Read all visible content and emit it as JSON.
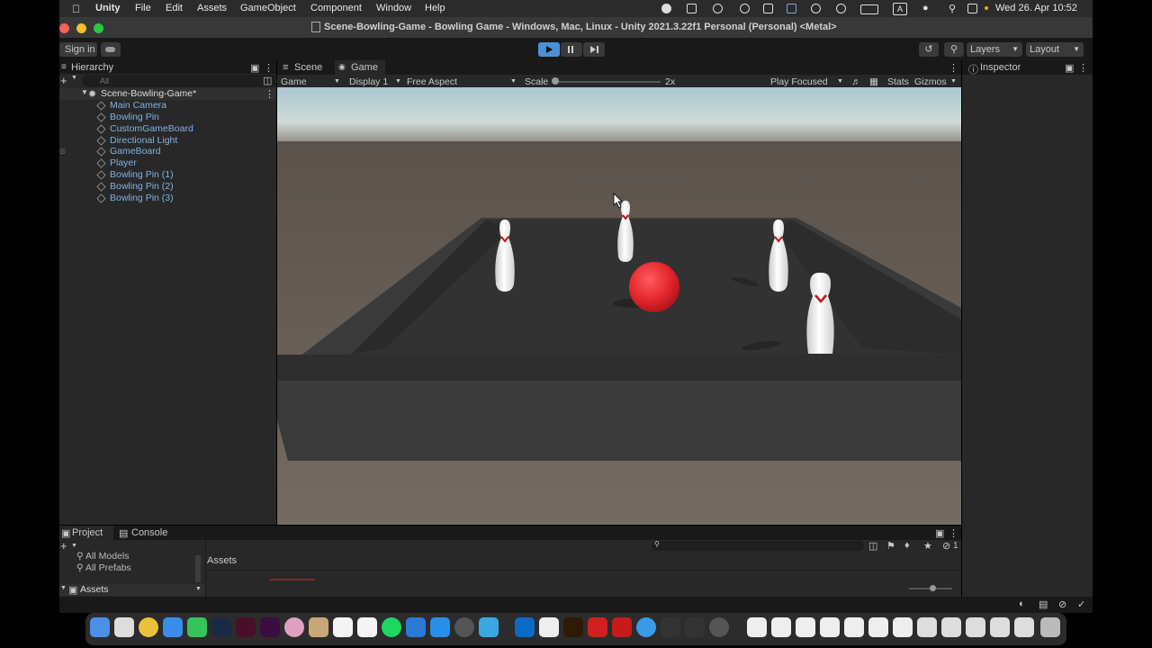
{
  "menubar": {
    "app": "Unity",
    "items": [
      "File",
      "Edit",
      "Assets",
      "GameObject",
      "Component",
      "Window",
      "Help"
    ],
    "clock": "Wed 26. Apr  10:52",
    "input_source": "A"
  },
  "window": {
    "title": "Scene-Bowling-Game - Bowling Game - Windows, Mac, Linux - Unity 2021.3.22f1 Personal (Personal) <Metal>"
  },
  "toolbar": {
    "sign_in": "Sign in",
    "layers": "Layers",
    "layout": "Layout"
  },
  "hierarchy": {
    "tab": "Hierarchy",
    "search_placeholder": "All",
    "scene": "Scene-Bowling-Game*",
    "items": [
      "Main Camera",
      "Bowling Pin",
      "CustomGameBoard",
      "Directional Light",
      "GameBoard",
      "Player",
      "Bowling Pin (1)",
      "Bowling Pin (2)",
      "Bowling Pin (3)"
    ]
  },
  "view": {
    "tabs": [
      "Scene",
      "Game"
    ],
    "active_tab": "Game",
    "game_dropdown": "Game",
    "display": "Display 1",
    "aspect": "Free Aspect",
    "scale_label": "Scale",
    "scale_value": "2x",
    "play_mode": "Play Focused",
    "stats": "Stats",
    "gizmos": "Gizmos"
  },
  "inspector": {
    "tab": "Inspector"
  },
  "project": {
    "tabs": [
      "Project",
      "Console"
    ],
    "tree": [
      "All Models",
      "All Prefabs"
    ],
    "assets_root": "Assets",
    "breadcrumb": "Assets",
    "count_badge": "1"
  },
  "colors": {
    "accent_link": "#7fb2e5",
    "play_button": "#4a90d9",
    "ball": "#e3262c"
  }
}
